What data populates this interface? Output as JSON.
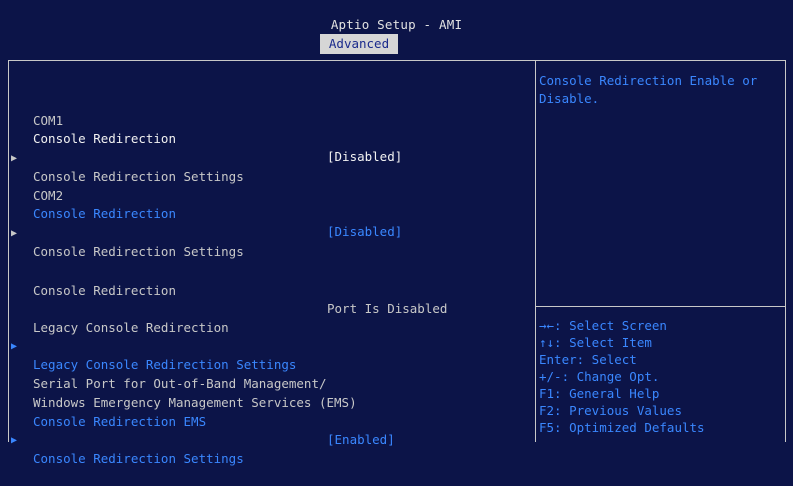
{
  "header": {
    "title": "Aptio Setup - AMI",
    "active_tab": "Advanced"
  },
  "main": {
    "com1": {
      "heading": "COM1",
      "redirection_label": "Console Redirection",
      "redirection_value": "[Disabled]",
      "settings_label": "Console Redirection Settings"
    },
    "com2": {
      "heading": "COM2",
      "redirection_label": "Console Redirection",
      "redirection_value": "[Disabled]",
      "settings_label": "Console Redirection Settings"
    },
    "console_redirection": {
      "label": "Console Redirection",
      "value": "Port Is Disabled"
    },
    "legacy": {
      "heading": "Legacy Console Redirection",
      "settings_label": "Legacy Console Redirection Settings"
    },
    "ems": {
      "heading_line1": "Serial Port for Out-of-Band Management/",
      "heading_line2": "Windows Emergency Management Services (EMS)",
      "redirection_label": "Console Redirection EMS",
      "redirection_value": "[Enabled]",
      "settings_label": "Console Redirection Settings"
    }
  },
  "help": {
    "description": "Console Redirection Enable or Disable.",
    "keys": [
      "→←: Select Screen",
      "↑↓: Select Item",
      "Enter: Select",
      "+/-: Change Opt.",
      "F1: General Help",
      "F2: Previous Values",
      "F5: Optimized Defaults"
    ]
  },
  "colors": {
    "background": "#0c1448",
    "highlight_text": "#3a87ff",
    "tab_background": "#d6d6d6"
  }
}
